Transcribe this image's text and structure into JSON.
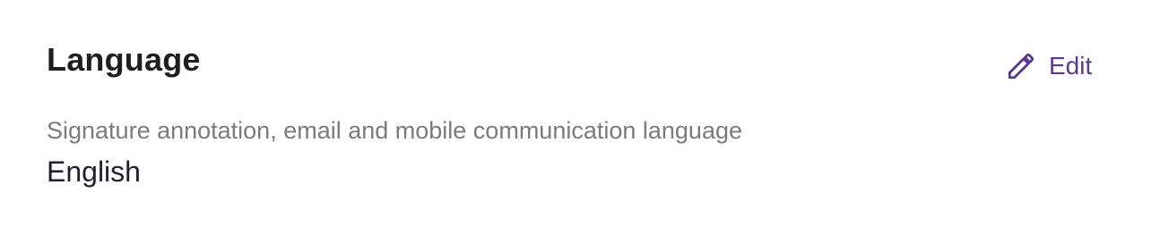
{
  "section": {
    "title": "Language",
    "edit_label": "Edit",
    "edit_icon": "pencil-icon",
    "description": "Signature annotation, email and mobile communication language",
    "value": "English"
  },
  "colors": {
    "accent": "#5b3a8c",
    "title": "#1f1f23",
    "description": "#7a7a7f",
    "value": "#1f2033"
  }
}
